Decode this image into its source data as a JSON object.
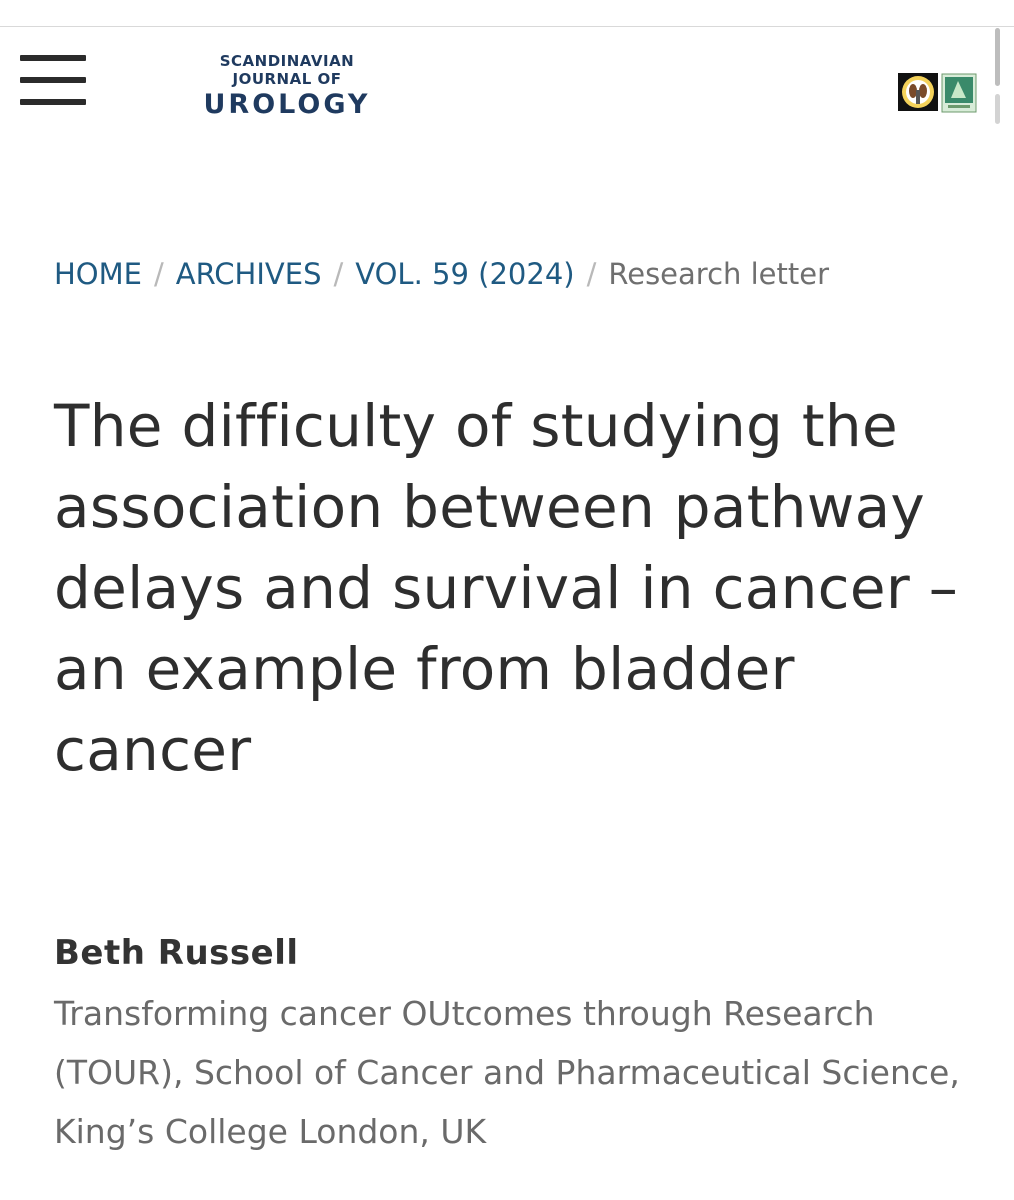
{
  "header": {
    "menu_icon": "hamburger-menu-icon",
    "logo": {
      "line1": "SCANDINAVIAN",
      "line2": "JOURNAL OF",
      "line3": "UROLOGY"
    },
    "society_logos": [
      "society-seal-logo",
      "society-emblem-logo"
    ]
  },
  "breadcrumb": {
    "items": [
      "HOME",
      "ARCHIVES",
      "VOL. 59 (2024)"
    ],
    "separator": "/",
    "current": "Research letter"
  },
  "article": {
    "title": "The difficulty of studying the association between pathway delays and survival in cancer – an example from bladder cancer",
    "author": "Beth Russell",
    "affiliation": "Transforming cancer OUtcomes through Research (TOUR), School of Cancer and Pharmaceutical Science, King’s College London, UK"
  },
  "colors": {
    "brand_navy": "#1f3a5f",
    "link_blue": "#1f5a82",
    "title_text": "#2e2e2e",
    "muted_text": "#6a6a6a"
  }
}
